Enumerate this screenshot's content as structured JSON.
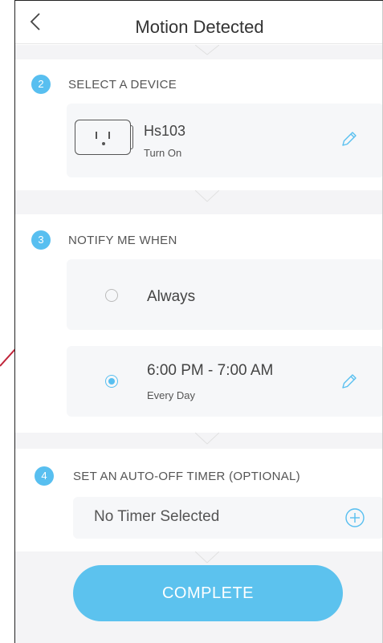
{
  "header": {
    "title": "Motion Detected"
  },
  "section_device": {
    "number": "2",
    "title": "SELECT A DEVICE",
    "device": {
      "name": "Hs103",
      "action": "Turn On"
    }
  },
  "section_notify": {
    "number": "3",
    "title": "NOTIFY ME WHEN",
    "options": [
      {
        "label": "Always",
        "selected": false
      },
      {
        "label": "6:00 PM - 7:00 AM",
        "sub": "Every Day",
        "selected": true
      }
    ]
  },
  "section_timer": {
    "number": "4",
    "title": "SET AN AUTO-OFF TIMER (OPTIONAL)",
    "value": "No Timer Selected"
  },
  "footer": {
    "complete_label": "COMPLETE"
  },
  "colors": {
    "accent": "#58bff0",
    "button": "#5cc2ee",
    "card": "#f6f7f9",
    "strip": "#f4f4f6"
  },
  "icons": [
    "back-chevron-icon",
    "plug-icon",
    "pencil-icon",
    "radio-icon",
    "plus-circle-icon"
  ]
}
